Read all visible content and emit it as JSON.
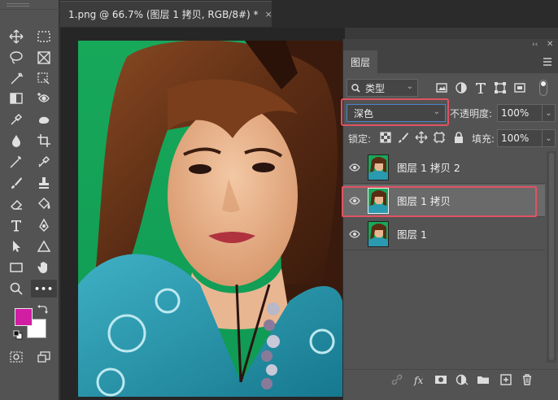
{
  "document": {
    "tab_title": "1.png @ 66.7% (图层 1 拷贝, RGB/8#) *",
    "close_glyph": "×"
  },
  "toolbar": {
    "tools": [
      "move-icon",
      "marquee-icon",
      "lasso-icon",
      "frame-icon",
      "quick-select-icon",
      "crop-icon",
      "object-select-icon",
      "eye-dropper-icon",
      "brush-heal-icon",
      "patch-icon",
      "eyedropper-icon",
      "crop-tool-icon",
      "dropper-icon",
      "brush-icon",
      "magic-wand-icon",
      "color-sampler-icon",
      "eraser-icon",
      "stamp-icon",
      "paint-bucket-icon",
      "pen-icon",
      "type-icon",
      "path-select-icon",
      "shape-icon",
      "triangle-icon",
      "rectangle-icon",
      "hand-icon",
      "zoom-icon",
      "more-icon"
    ],
    "more_label": "•••",
    "foreground_color": "#d11ea3",
    "background_color": "#ffffff"
  },
  "panel": {
    "tab_label": "图层",
    "collapse_glyph": "‹‹",
    "close_glyph": "✕",
    "filter": {
      "label": "类型",
      "chevron": "⌄"
    },
    "blend": {
      "mode": "深色",
      "chevron": "⌄"
    },
    "opacity": {
      "label": "不透明度:",
      "value": "100%",
      "chevron": "⌄"
    },
    "lock": {
      "label": "锁定:"
    },
    "fill": {
      "label": "填充:",
      "value": "100%",
      "chevron": "⌄"
    },
    "layers": [
      {
        "name": "图层 1 拷贝 2",
        "selected": false
      },
      {
        "name": "图层 1 拷贝",
        "selected": true
      },
      {
        "name": "图层 1",
        "selected": false
      }
    ],
    "accent_highlight": "#e05263"
  }
}
